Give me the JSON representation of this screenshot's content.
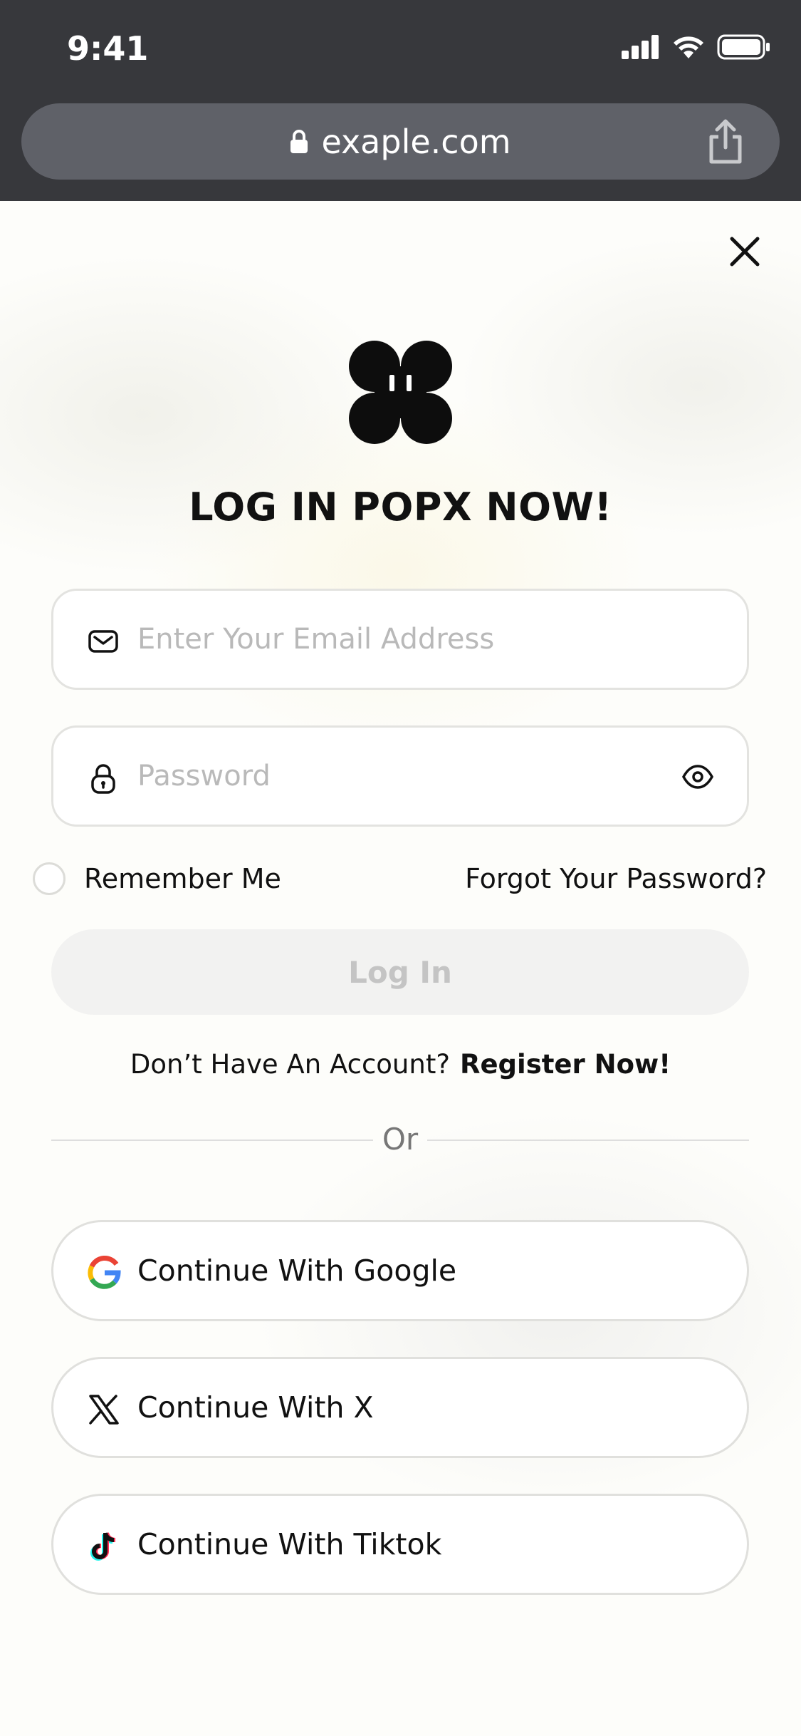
{
  "status_bar": {
    "time": "9:41"
  },
  "browser": {
    "url": "exaple.com"
  },
  "page": {
    "title": "LOG IN POPX NOW!",
    "email_field": {
      "placeholder": "Enter Your Email Address",
      "value": ""
    },
    "password_field": {
      "placeholder": "Password",
      "value": ""
    },
    "remember_label": "Remember Me",
    "forgot_label": "Forgot Your Password?",
    "login_label": "Log In",
    "register_prompt": "Don’t Have An Account?",
    "register_link": "Register Now!",
    "divider_label": "Or",
    "social": [
      {
        "label": "Continue With Google",
        "icon": "google-icon"
      },
      {
        "label": "Continue With X",
        "icon": "x-icon"
      },
      {
        "label": "Continue With Tiktok",
        "icon": "tiktok-icon"
      }
    ]
  },
  "colors": {
    "chrome_bg": "#37383c",
    "urlbar_bg": "#5f6168",
    "text": "#111111",
    "placeholder": "#b9b9b9",
    "disabled_button_bg": "#f2f2f1",
    "disabled_button_text": "#c4c4c4"
  }
}
